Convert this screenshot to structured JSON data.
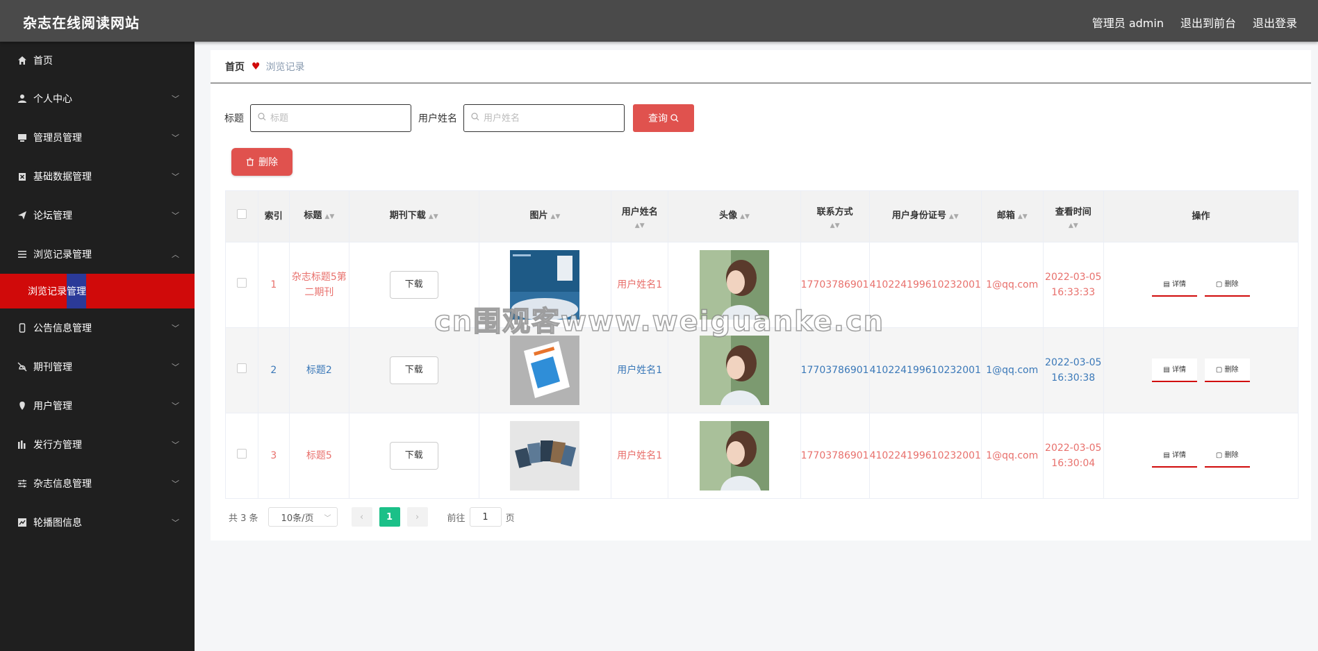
{
  "header": {
    "site_title": "杂志在线阅读网站",
    "admin_label": "管理员 admin",
    "to_front": "退出到前台",
    "logout": "退出登录"
  },
  "sidebar": {
    "items": [
      {
        "label": "首页",
        "icon": "home-icon"
      },
      {
        "label": "个人中心",
        "icon": "user-icon"
      },
      {
        "label": "管理员管理",
        "icon": "monitor-icon"
      },
      {
        "label": "基础数据管理",
        "icon": "clipboard-icon"
      },
      {
        "label": "论坛管理",
        "icon": "send-icon"
      },
      {
        "label": "浏览记录管理",
        "icon": "list-icon"
      },
      {
        "label": "公告信息管理",
        "icon": "phone-icon"
      },
      {
        "label": "期刊管理",
        "icon": "bell-off-icon"
      },
      {
        "label": "用户管理",
        "icon": "location-icon"
      },
      {
        "label": "发行方管理",
        "icon": "bar-chart-icon"
      },
      {
        "label": "杂志信息管理",
        "icon": "sliders-icon"
      },
      {
        "label": "轮播图信息",
        "icon": "trend-icon"
      }
    ],
    "active_sub": "浏览记录管理"
  },
  "breadcrumb": {
    "home": "首页",
    "current": "浏览记录"
  },
  "search": {
    "title_label": "标题",
    "title_placeholder": "标题",
    "user_label": "用户姓名",
    "user_placeholder": "用户姓名",
    "query_label": "查询"
  },
  "actions": {
    "delete_label": "删除"
  },
  "table": {
    "headers": {
      "index": "索引",
      "title": "标题",
      "download": "期刊下载",
      "image": "图片",
      "username": "用户姓名",
      "avatar": "头像",
      "phone": "联系方式",
      "idcard": "用户身份证号",
      "email": "邮箱",
      "viewtime": "查看时间",
      "ops": "操作"
    },
    "rows": [
      {
        "index": "1",
        "title": "杂志标题5第二期刊",
        "download": "下载",
        "username": "用户姓名1",
        "phone": "17703786901",
        "idcard": "410224199610232001",
        "email": "1@qq.com",
        "viewtime": "2022-03-05 16:33:33",
        "detail": "详情",
        "delete": "删除"
      },
      {
        "index": "2",
        "title": "标题2",
        "download": "下载",
        "username": "用户姓名1",
        "phone": "17703786901",
        "idcard": "410224199610232001",
        "email": "1@qq.com",
        "viewtime": "2022-03-05 16:30:38",
        "detail": "详情",
        "delete": "删除"
      },
      {
        "index": "3",
        "title": "标题5",
        "download": "下载",
        "username": "用户姓名1",
        "phone": "17703786901",
        "idcard": "410224199610232001",
        "email": "1@qq.com",
        "viewtime": "2022-03-05 16:30:04",
        "detail": "详情",
        "delete": "删除"
      }
    ]
  },
  "pager": {
    "total": "共 3 条",
    "page_size": "10条/页",
    "current": "1",
    "goto_prefix": "前往",
    "goto_value": "1",
    "goto_suffix": "页"
  },
  "watermark": "cn围观客www.weiguanke.cn",
  "colors": {
    "accent": "#e0524e",
    "sidebar_active": "#d00a0a",
    "pager_current": "#1bc088"
  }
}
